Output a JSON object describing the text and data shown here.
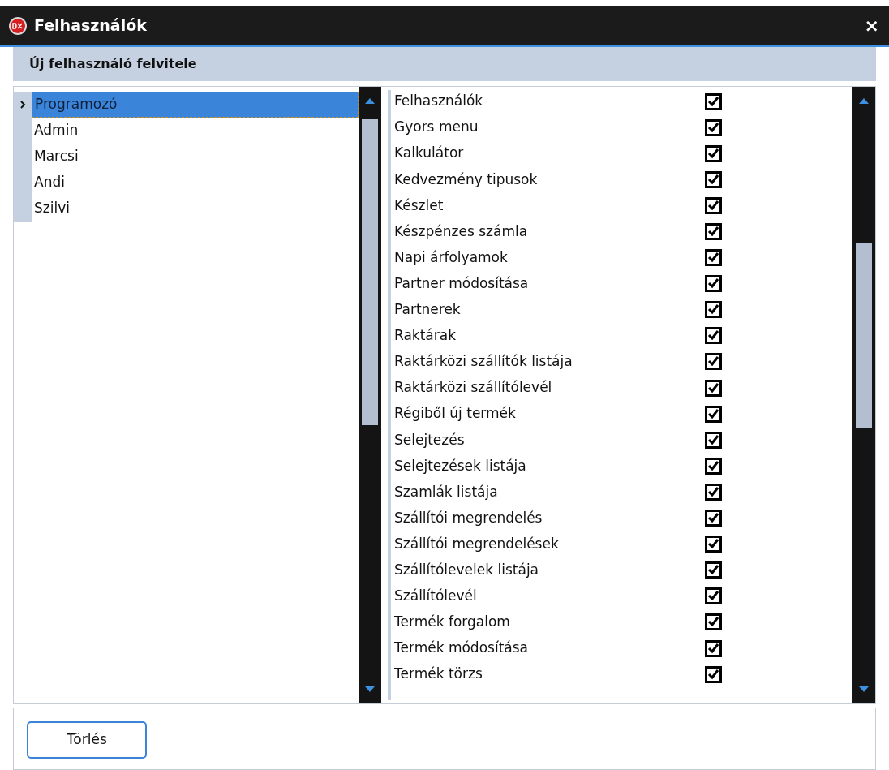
{
  "window": {
    "title": "Felhasználók",
    "close": "×"
  },
  "header": {
    "title": "Új felhasználó felvitele"
  },
  "users": [
    {
      "name": "Programozó",
      "selected": true
    },
    {
      "name": "Admin",
      "selected": false
    },
    {
      "name": "Marcsi",
      "selected": false
    },
    {
      "name": "Andi",
      "selected": false
    },
    {
      "name": "Szilvi",
      "selected": false
    }
  ],
  "permissions": [
    {
      "name": "Felhasználók",
      "checked": true
    },
    {
      "name": "Gyors menu",
      "checked": true
    },
    {
      "name": "Kalkulátor",
      "checked": true
    },
    {
      "name": "Kedvezmény tipusok",
      "checked": true
    },
    {
      "name": "Készlet",
      "checked": true
    },
    {
      "name": "Készpénzes számla",
      "checked": true
    },
    {
      "name": "Napi árfolyamok",
      "checked": true
    },
    {
      "name": "Partner módosítása",
      "checked": true
    },
    {
      "name": "Partnerek",
      "checked": true
    },
    {
      "name": "Raktárak",
      "checked": true
    },
    {
      "name": "Raktárközi szállítók listája",
      "checked": true
    },
    {
      "name": "Raktárközi szállítólevél",
      "checked": true
    },
    {
      "name": "Régiből új termék",
      "checked": true
    },
    {
      "name": "Selejtezés",
      "checked": true
    },
    {
      "name": "Selejtezések listája",
      "checked": true
    },
    {
      "name": "Szamlák listája",
      "checked": true
    },
    {
      "name": "Szállítói megrendelés",
      "checked": true
    },
    {
      "name": "Szállítói megrendelések",
      "checked": true
    },
    {
      "name": "Szállítólevelek listája",
      "checked": true
    },
    {
      "name": "Szállítólevél",
      "checked": true
    },
    {
      "name": "Termék forgalom",
      "checked": true
    },
    {
      "name": "Termék módosítása",
      "checked": true
    },
    {
      "name": "Termék törzs",
      "checked": true
    }
  ],
  "buttons": [
    {
      "label": "Törlés"
    }
  ]
}
